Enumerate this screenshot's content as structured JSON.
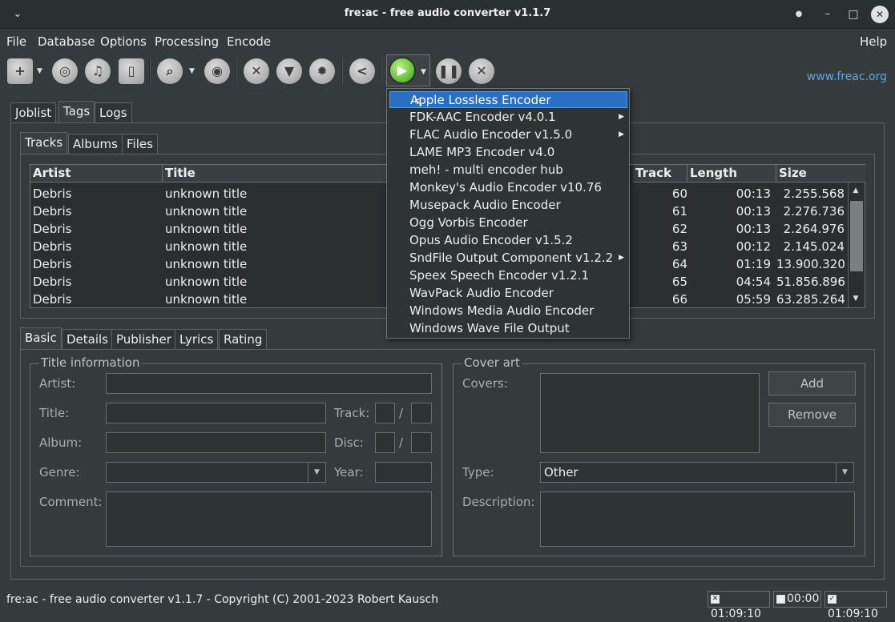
{
  "window": {
    "title": "fre:ac - free audio converter v1.1.7",
    "menu_btn": "⌄",
    "dot": "●",
    "minimize": "–",
    "maximize": "□",
    "close": "✕"
  },
  "menubar": [
    "File",
    "Database",
    "Options",
    "Processing",
    "Encode",
    "Help"
  ],
  "toolbar": {
    "website": "www.freac.org"
  },
  "main_tabs": [
    "Joblist",
    "Tags",
    "Logs"
  ],
  "sub_tabs": [
    "Tracks",
    "Albums",
    "Files"
  ],
  "table": {
    "columns": [
      "Artist",
      "Title",
      "Track",
      "Length",
      "Size"
    ],
    "rows": [
      {
        "artist": "Debris",
        "title": "unknown title",
        "track": "60",
        "length": "00:13",
        "size": "2.255.568"
      },
      {
        "artist": "Debris",
        "title": "unknown title",
        "track": "61",
        "length": "00:13",
        "size": "2.276.736"
      },
      {
        "artist": "Debris",
        "title": "unknown title",
        "track": "62",
        "length": "00:13",
        "size": "2.264.976"
      },
      {
        "artist": "Debris",
        "title": "unknown title",
        "track": "63",
        "length": "00:12",
        "size": "2.145.024"
      },
      {
        "artist": "Debris",
        "title": "unknown title",
        "track": "64",
        "length": "01:19",
        "size": "13.900.320"
      },
      {
        "artist": "Debris",
        "title": "unknown title",
        "track": "65",
        "length": "04:54",
        "size": "51.856.896"
      },
      {
        "artist": "Debris",
        "title": "unknown title",
        "track": "66",
        "length": "05:59",
        "size": "63.285.264"
      }
    ]
  },
  "encoder_menu": {
    "items": [
      {
        "label": "Apple Lossless Encoder",
        "submenu": false,
        "highlighted": true
      },
      {
        "label": "FDK-AAC Encoder v4.0.1",
        "submenu": true
      },
      {
        "label": "FLAC Audio Encoder v1.5.0",
        "submenu": true
      },
      {
        "label": "LAME MP3 Encoder v4.0",
        "submenu": false
      },
      {
        "label": "meh! - multi encoder hub",
        "submenu": false
      },
      {
        "label": "Monkey's Audio Encoder v10.76",
        "submenu": false
      },
      {
        "label": "Musepack Audio Encoder",
        "submenu": false
      },
      {
        "label": "Ogg Vorbis Encoder",
        "submenu": false
      },
      {
        "label": "Opus Audio Encoder v1.5.2",
        "submenu": false
      },
      {
        "label": "SndFile Output Component v1.2.2",
        "submenu": true
      },
      {
        "label": "Speex Speech Encoder v1.2.1",
        "submenu": false
      },
      {
        "label": "WavPack Audio Encoder",
        "submenu": false
      },
      {
        "label": "Windows Media Audio Encoder",
        "submenu": false
      },
      {
        "label": "Windows Wave File Output",
        "submenu": false
      }
    ]
  },
  "detail_tabs": [
    "Basic",
    "Details",
    "Publisher",
    "Lyrics",
    "Rating"
  ],
  "title_info": {
    "group": "Title information",
    "artist": "Artist:",
    "title": "Title:",
    "album": "Album:",
    "genre": "Genre:",
    "comment": "Comment:",
    "track": "Track:",
    "disc": "Disc:",
    "year": "Year:",
    "slash": "/"
  },
  "cover_art": {
    "group": "Cover art",
    "covers": "Covers:",
    "add": "Add",
    "remove": "Remove",
    "type": "Type:",
    "type_value": "Other",
    "description": "Description:"
  },
  "statusbar": {
    "text": "fre:ac - free audio converter v1.1.7 - Copyright (C) 2001-2023 Robert Kausch",
    "time_total": "01:09:10",
    "time_selected": "00:00",
    "time_checked": "01:09:10"
  }
}
